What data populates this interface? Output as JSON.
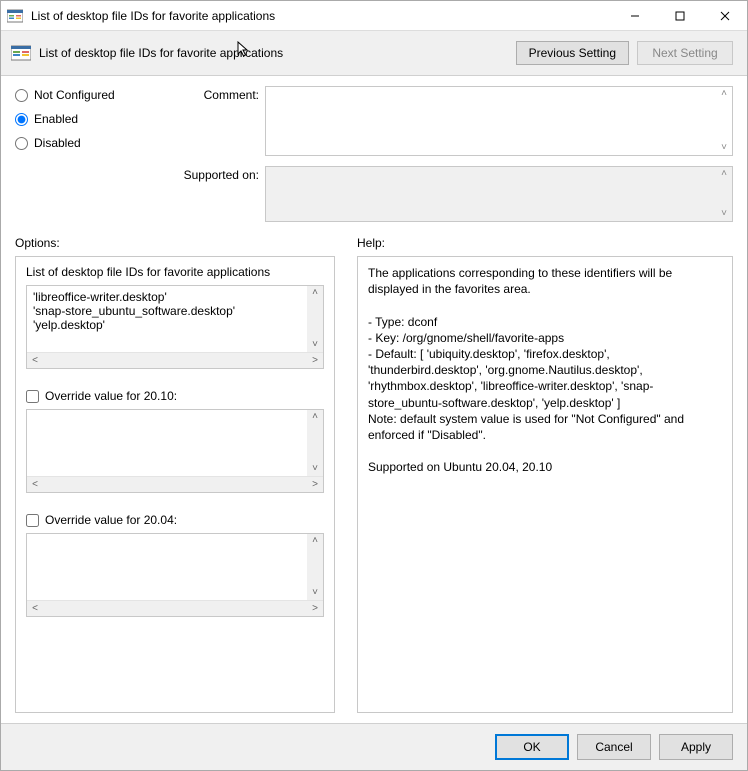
{
  "window": {
    "title": "List of desktop file IDs for favorite applications"
  },
  "header": {
    "title": "List of desktop file IDs for favorite applications",
    "prev_button": "Previous Setting",
    "next_button": "Next Setting"
  },
  "state": {
    "not_configured_label": "Not Configured",
    "enabled_label": "Enabled",
    "disabled_label": "Disabled",
    "selected": "enabled"
  },
  "comment": {
    "label": "Comment:",
    "value": ""
  },
  "supported": {
    "label": "Supported on:",
    "value": ""
  },
  "columns": {
    "options_label": "Options:",
    "help_label": "Help:"
  },
  "options": {
    "list_field": {
      "label": "List of desktop file IDs for favorite applications",
      "value": "'libreoffice-writer.desktop'\n'snap-store_ubuntu_software.desktop'\n'yelp.desktop'"
    },
    "override_2010": {
      "label": "Override value for 20.10:",
      "checked": false,
      "value": ""
    },
    "override_2004": {
      "label": "Override value for 20.04:",
      "checked": false,
      "value": ""
    }
  },
  "help": {
    "text": "The applications corresponding to these identifiers will be displayed in the favorites area.\n\n- Type: dconf\n- Key: /org/gnome/shell/favorite-apps\n- Default: [ 'ubiquity.desktop', 'firefox.desktop', 'thunderbird.desktop', 'org.gnome.Nautilus.desktop', 'rhythmbox.desktop', 'libreoffice-writer.desktop', 'snap-store_ubuntu-software.desktop', 'yelp.desktop' ]\nNote: default system value is used for \"Not Configured\" and enforced if \"Disabled\".\n\nSupported on Ubuntu 20.04, 20.10"
  },
  "footer": {
    "ok": "OK",
    "cancel": "Cancel",
    "apply": "Apply"
  }
}
